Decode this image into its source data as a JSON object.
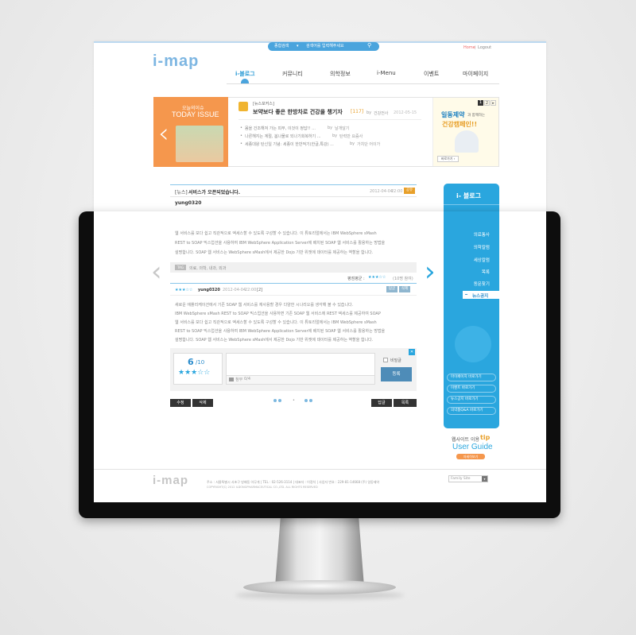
{
  "header": {
    "logo": "i-map",
    "search_left": "종합검색",
    "search_placeholder": "검색어를 입력해주세요",
    "search_arrow": "▾",
    "links": [
      "Home",
      "Logout"
    ],
    "link_sep": "|"
  },
  "nav": [
    "i-블로그",
    "커뮤니티",
    "의학정보",
    "i-Menu",
    "이벤트",
    "마이페이지"
  ],
  "issue": {
    "small": "오늘의이슈",
    "big": "TODAY ISSUE",
    "tag": "[뉴스포커스]",
    "headline": "보약보다 좋은 한방차로 건강을 챙기자",
    "count": "[117]",
    "by": "by",
    "author": "건강전사",
    "date": "2012-05-15",
    "items": [
      {
        "text": "몸을 건조해져 가는 피부, 이것이 정답!! ...",
        "by": "by",
        "author": "날개달기"
      },
      {
        "text": "나른해지는 계절, 봄나물로 되나기회복하기 ...",
        "by": "by",
        "author": "탄력만 요즘사"
      },
      {
        "text": "세종대왕 탄신일 기념: 세종이 한반적기(한글,특강) ...",
        "by": "by",
        "author": "가치단 어이가"
      }
    ],
    "page_current": "1",
    "page_next": "2",
    "page_arrow": "▸"
  },
  "ad": {
    "title": "일동제약",
    "title_small": "과 함께하는",
    "sub": "건강캠페인!!",
    "button": "바로가기 ›"
  },
  "post": {
    "tag": "[뉴스]",
    "title": "서비스가 오픈되었습니다.",
    "date": "2012-04-04",
    "time": "22:00",
    "badge": "공유",
    "user": "yung0320",
    "body": [
      "웹 서비스를 보다 쉽고 직관적으로 엑세스할 수 있도록 구성할 수 있습니다. 이 튜토리얼에서는 IBM WebSphere sMash",
      "REST to SOAP 믹스업션을 사용하여 IBM WebSphere Application Server에 배치된 SOAP 웹 서비스를 활용하는 방법을",
      "설명합니다. SOAP 웹 서비스는 WebSphere sMash에서 제공한 Dojo 기반 위젯에 데이터를 제공하는 역할을 합니다."
    ],
    "tags_label": "TAG",
    "tags": "의료, 의학, 내과, 외과",
    "rating_label": "평점평균 :",
    "rating_stars": "★★★☆☆",
    "rating_count": "(10명 참여)"
  },
  "comment": {
    "stars": "★★★☆☆",
    "user": "yung0320",
    "date": "2012-04-04",
    "time": "22:00",
    "count": "[2]",
    "reply": "답글",
    "delete": "삭제",
    "body": [
      "새로운 애플리케이션에서 기존 SOAP 웹 서비스를 재사용할 경우 다양한 시나리오를 생각해 볼 수 있습니다.",
      "IBM WebSphere sMash REST to SOAP 믹스업션을 사용하면 기존 SOAP 웹 서비스에 REST 엑세스를 제공하여 SOAP",
      "웹 서비스를 보다 쉽고 직관적으로 엑세스할 수 있도록 구성할 수 있습니다. 이 튜토리얼에서는 IBM WebSphere sMash",
      "REST to SOAP 믹스업션을 사용하여 IBM WebSphere Application Server에 배치된 SOAP 웹 서비스를 활용하는 방법을",
      "설명합니다. SOAP 웹 서비스는 WebSphere sMash에서 제공한 Dojo 기반 위젯에 데이터를 제공하는 역할을 합니다."
    ]
  },
  "form": {
    "score": "6",
    "score_total": "/10",
    "stars": "★★★☆☆",
    "secret": "비밀글",
    "submit": "등록",
    "file_label": "첨부",
    "file_count": "0/4",
    "close": "✕"
  },
  "actions": {
    "edit": "수정",
    "delete": "삭제",
    "reply": "답글",
    "list": "목록"
  },
  "sidebar": {
    "title": "i- 블로그",
    "menu": [
      "의료통사",
      "의학칼럼",
      "세상칼럼",
      "목록",
      "동문찾기",
      "뉴스공지"
    ],
    "links": [
      "마이페이지 바로가기",
      "이벤트 바로가기",
      "뉴스공지 바로가기",
      "의약품Q&A 바로가기"
    ],
    "tip_small": "웹사이트 이용",
    "tip_accent": "tip",
    "guide": "User Guide",
    "guide_btn": "자세히보기"
  },
  "footer": {
    "logo": "i-map",
    "address": "주소 : 서울특별시 서초구 방배동 아무개 | TEL : 02-526-3114 | 대표자 : 이정치 | 사업자 번호 : 229-81-14668 (주) 일동제약",
    "copyright": "COPYRIGHT(C) 2012 ILDONGPHARMACEUTICAL CO.,LTD. ALL RIGHTS RESERVED",
    "family_site": "Family Site"
  },
  "colors": {
    "accent": "#2aa6de",
    "orange": "#f5974d",
    "logo": "#7db6e2",
    "highlight": "#e8a02a"
  }
}
